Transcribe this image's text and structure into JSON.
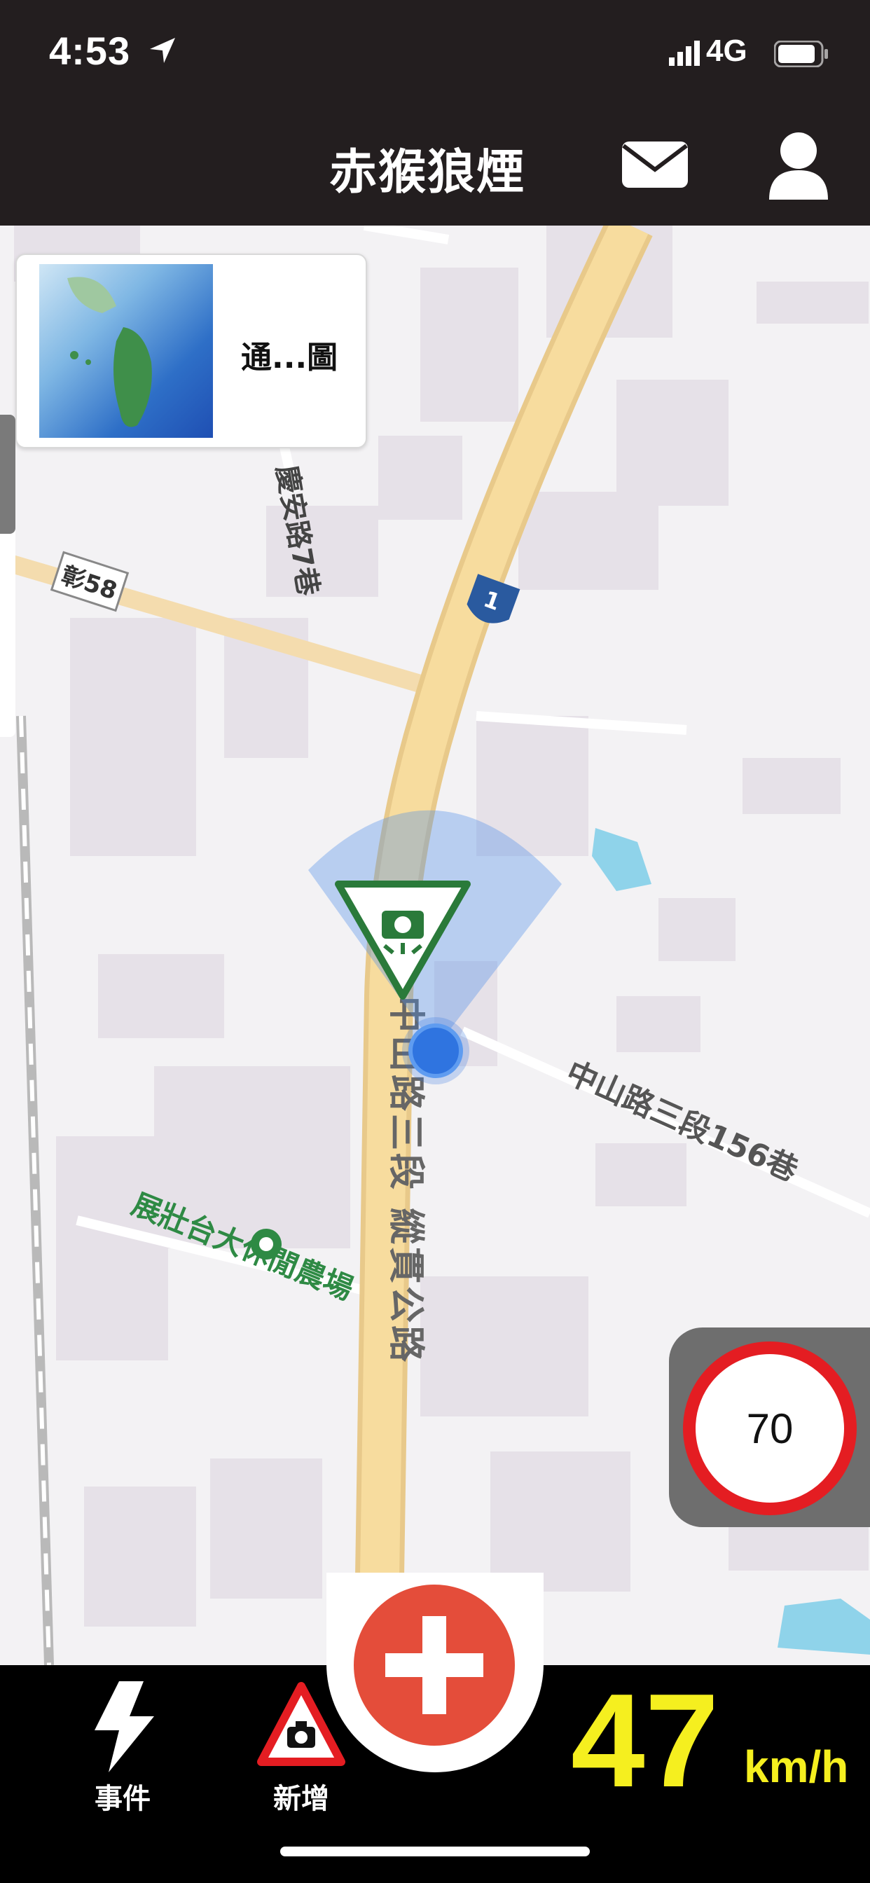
{
  "status_bar": {
    "time": "4:53",
    "network": "4G",
    "icons": [
      "location-arrow-icon",
      "signal-icon",
      "battery-icon"
    ]
  },
  "header": {
    "title": "赤猴狼煙",
    "icons": [
      "mail-icon",
      "account-icon"
    ]
  },
  "map": {
    "layer_card_label": "通...圖",
    "road_labels": {
      "lane_7": "慶安路7巷",
      "route_58": "彰58",
      "highway_shield": "1",
      "main_road": "中山路三段 縱貫公路",
      "alley_156": "中山路三段156巷",
      "poi": "展壯台大休閒農場"
    },
    "markers": [
      "speed-camera-icon",
      "current-location-icon",
      "poi-pin-icon"
    ]
  },
  "speed_limit": {
    "value": "70"
  },
  "bottom_bar": {
    "events_label": "事件",
    "add_label": "新增",
    "speed_value": "47",
    "speed_unit": "km/h",
    "icons": [
      "lightning-icon",
      "warning-camera-icon",
      "plus-icon"
    ]
  },
  "colors": {
    "header_bg": "#231e1f",
    "road_main": "#f5d89a",
    "speed_text": "#f5ef1f",
    "fab_red": "#e44d3a",
    "speed_limit_ring": "#e41d22",
    "camera_green": "#2a7a3a",
    "location_blue": "#2f74e0"
  }
}
